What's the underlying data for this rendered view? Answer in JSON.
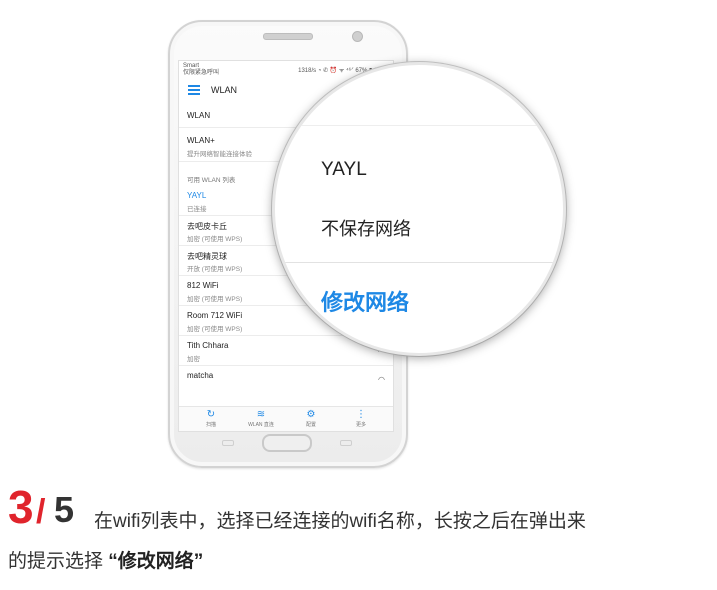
{
  "statusbar": {
    "left_line1": "Smart",
    "left_line2": "仅限紧急呼叫",
    "right": "1318/s ◔ ✆ ⏰ ᯤ ⁴⁶ᐟ 67% ▮ 16:40"
  },
  "appbar": {
    "title": "WLAN"
  },
  "list": {
    "wlan": "WLAN",
    "wlan_plus_title": "WLAN+",
    "wlan_plus_sub": "提升网络智能连接体验",
    "section": "可用 WLAN 列表",
    "networks": [
      {
        "name": "YAYL",
        "status": "已连接"
      },
      {
        "name": "去吧皮卡丘",
        "status": "加密 (可使用 WPS)"
      },
      {
        "name": "去吧精灵球",
        "status": "开放 (可使用 WPS)"
      },
      {
        "name": "812 WiFi",
        "status": "加密 (可使用 WPS)"
      },
      {
        "name": "Room 712 WiFi",
        "status": "加密 (可使用 WPS)"
      },
      {
        "name": "Tith Chhara",
        "status": "加密"
      },
      {
        "name": "matcha",
        "status": ""
      }
    ]
  },
  "bottom_nav": {
    "scan": "扫描",
    "wlan_direct": "WLAN 直连",
    "config": "配置",
    "more": "更多"
  },
  "popup": {
    "network_name": "YAYL",
    "forget": "不保存网络",
    "modify": "修改网络"
  },
  "caption": {
    "step_current": "3",
    "step_slash": "/",
    "step_total": "5",
    "line1": "在wifi列表中，选择已经连接的wifi名称，长按之后在弹出来",
    "line2_prefix": "的提示选择 ",
    "line2_highlight": "“修改网络”"
  },
  "colors": {
    "accent": "#1e88e5",
    "step_red": "#e0242c"
  }
}
